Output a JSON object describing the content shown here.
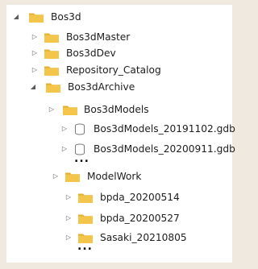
{
  "tree": {
    "root": {
      "label": "Bos3d",
      "icon": "folder-icon",
      "state": "expanded"
    },
    "level1": [
      {
        "label": "Bos3dMaster",
        "icon": "folder-icon",
        "state": "collapsed"
      },
      {
        "label": "Bos3dDev",
        "icon": "folder-icon",
        "state": "collapsed"
      },
      {
        "label": "Repository_Catalog",
        "icon": "folder-icon",
        "state": "collapsed"
      },
      {
        "label": "Bos3dArchive",
        "icon": "folder-icon",
        "state": "expanded"
      }
    ],
    "archive_children": [
      {
        "label": "Bos3dModels",
        "icon": "folder-icon",
        "state": "collapsed"
      }
    ],
    "models_children": [
      {
        "label": "Bos3dModels_20191102.gdb",
        "icon": "geodatabase-icon",
        "state": "collapsed"
      },
      {
        "label": "Bos3dModels_20200911.gdb",
        "icon": "geodatabase-icon",
        "state": "collapsed"
      }
    ],
    "modelwork": {
      "label": "ModelWork",
      "icon": "folder-icon",
      "state": "collapsed"
    },
    "modelwork_children": [
      {
        "label": "bpda_20200514",
        "icon": "folder-icon",
        "state": "collapsed"
      },
      {
        "label": "bpda_20200527",
        "icon": "folder-icon",
        "state": "collapsed"
      },
      {
        "label": "Sasaki_20210805",
        "icon": "folder-icon",
        "state": "collapsed"
      }
    ],
    "ellipsis": "..."
  },
  "colors": {
    "folder": "#f3c54a",
    "folder_tab": "#e5b030",
    "db_outline": "#7a7a7a",
    "background": "#efe9df"
  }
}
